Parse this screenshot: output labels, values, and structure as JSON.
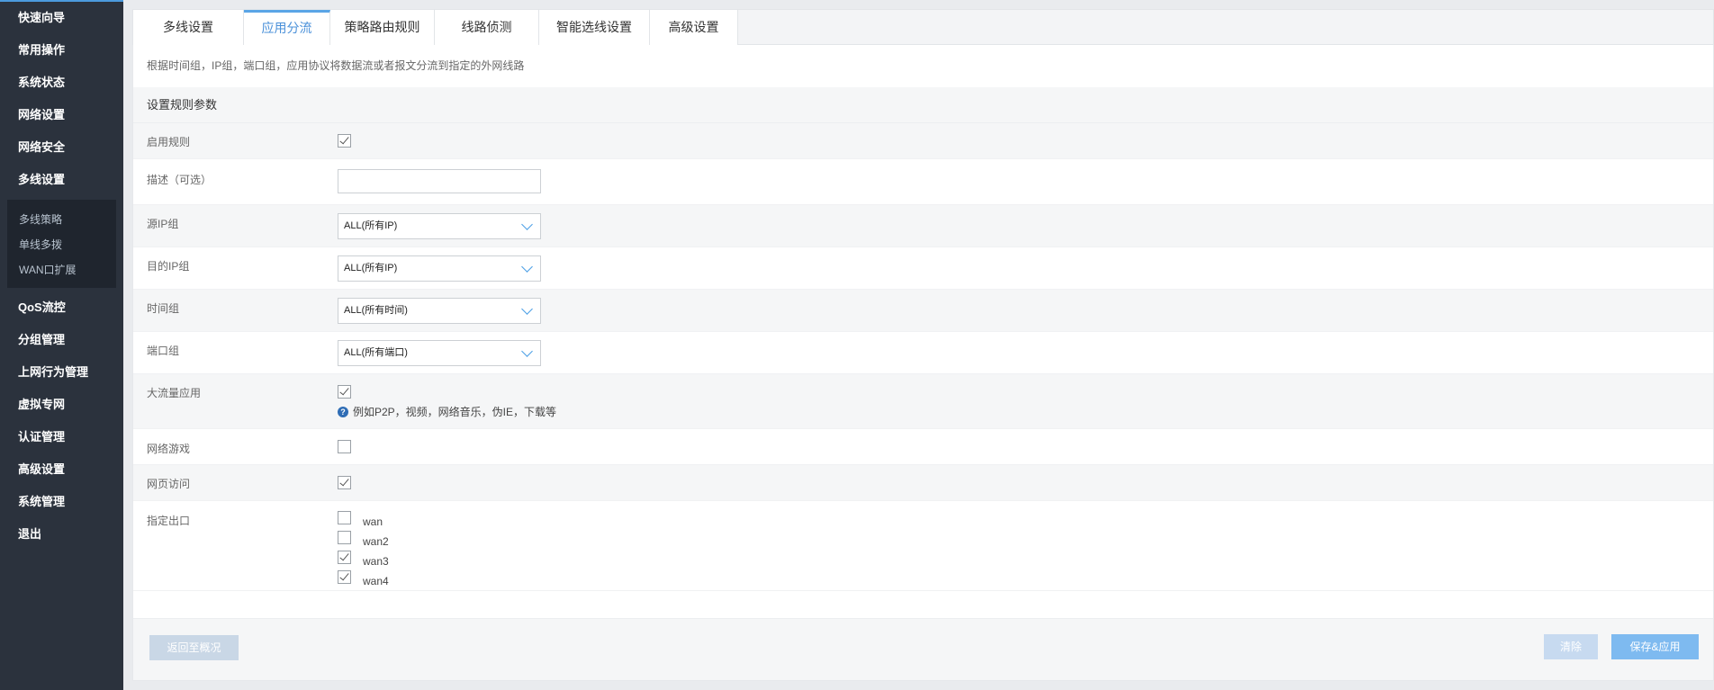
{
  "sidebar": {
    "items_top": [
      "快速向导",
      "常用操作",
      "系统状态",
      "网络设置",
      "网络安全",
      "多线设置"
    ],
    "submenu": [
      "多线策略",
      "单线多拨",
      "WAN口扩展"
    ],
    "items_bottom": [
      "QoS流控",
      "分组管理",
      "上网行为管理",
      "虚拟专网",
      "认证管理",
      "高级设置",
      "系统管理",
      "退出"
    ]
  },
  "tabs": [
    "多线设置",
    "应用分流",
    "策略路由规则",
    "线路侦测",
    "智能选线设置",
    "高级设置"
  ],
  "active_tab": "应用分流",
  "description": "根据时间组，IP组，端口组，应用协议将数据流或者报文分流到指定的外网线路",
  "section_title": "设置规则参数",
  "form": {
    "enable_rule": {
      "label": "启用规则",
      "checked": true
    },
    "desc_field": {
      "label": "描述（可选）",
      "value": ""
    },
    "src_ip": {
      "label": "源IP组",
      "value": "ALL(所有IP)"
    },
    "dst_ip": {
      "label": "目的IP组",
      "value": "ALL(所有IP)"
    },
    "time_group": {
      "label": "时间组",
      "value": "ALL(所有时间)"
    },
    "port_group": {
      "label": "端口组",
      "value": "ALL(所有端口)"
    },
    "bulk_app": {
      "label": "大流量应用",
      "checked": true,
      "hint": "例如P2P，视频，网络音乐，伪IE，下载等"
    },
    "online_game": {
      "label": "网络游戏",
      "checked": false
    },
    "web_access": {
      "label": "网页访问",
      "checked": true
    },
    "outlets": {
      "label": "指定出口",
      "items": [
        {
          "name": "wan",
          "checked": false
        },
        {
          "name": "wan2",
          "checked": false
        },
        {
          "name": "wan3",
          "checked": true
        },
        {
          "name": "wan4",
          "checked": true
        }
      ]
    }
  },
  "buttons": {
    "back": "返回至概况",
    "clear": "清除",
    "save": "保存&应用"
  },
  "colors": {
    "sidebar_bg": "#2b323d",
    "accent": "#4a90d9",
    "save_btn": "#7ebaf0"
  },
  "icons": {
    "help": "question-circle-icon",
    "dropdown": "chevron-down-icon"
  }
}
